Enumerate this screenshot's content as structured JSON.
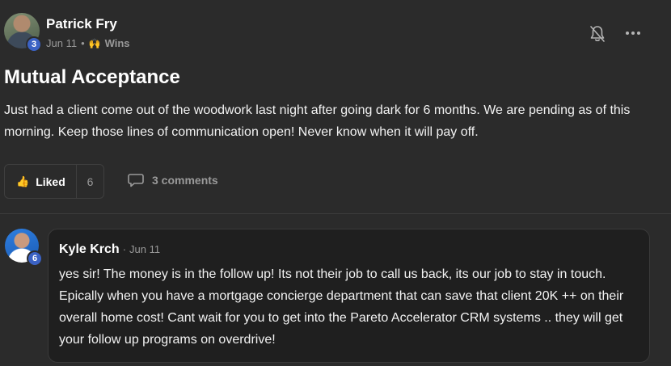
{
  "post": {
    "author": {
      "name": "Patrick Fry",
      "level": "3",
      "avatar_icon": "user-avatar"
    },
    "meta": {
      "date": "Jun 11",
      "separator": "•",
      "category_icon": "raised-hands-icon",
      "category": "Wins"
    },
    "title": "Mutual Acceptance",
    "body": "Just had a client come out of the woodwork last night after going dark for 6 months. We are pending as of this morning. Keep those lines of communication open! Never know when it will pay off.",
    "actions": {
      "like_label": "Liked",
      "like_count": "6",
      "comments_label": "3 comments"
    }
  },
  "comment": {
    "author": {
      "name": "Kyle Krch",
      "level": "6"
    },
    "separator": "·",
    "date": "Jun 11",
    "body": "yes sir! The money is in the follow up! Its not their job to call us back, its our job to stay in touch. Epically when you have a mortgage concierge department that can save that client 20K ++ on their overall home cost! Cant wait for you to get into the Pareto Accelerator CRM systems .. they will get your follow up programs on overdrive!"
  },
  "colors": {
    "background": "#2b2b2b",
    "comment_background": "#1f1f1f",
    "level_badge": "#3b62c4",
    "accent_yellow": "#e3a920",
    "muted_text": "#9a9a9a"
  }
}
